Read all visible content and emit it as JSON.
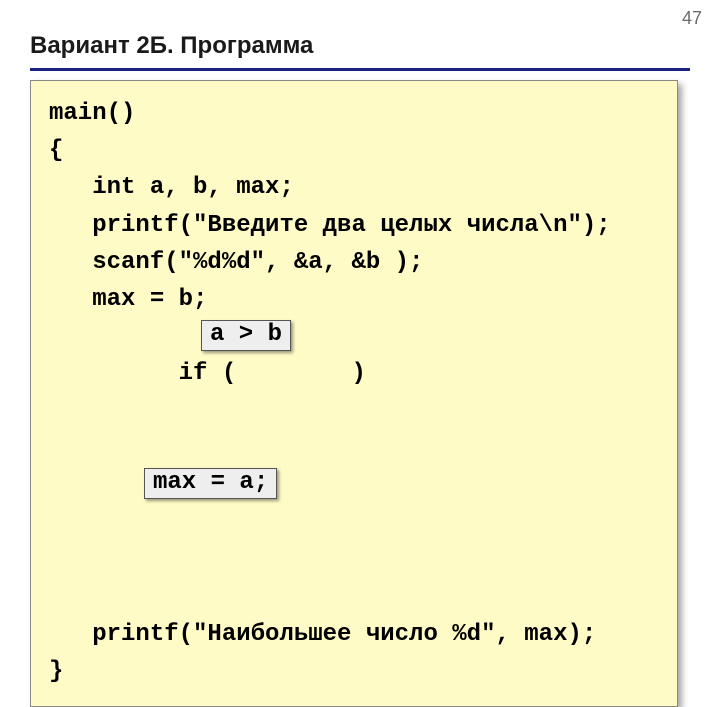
{
  "page_number": "47",
  "title": "Вариант 2Б. Программа",
  "code": {
    "l1": "main()",
    "l2": "{",
    "l3": "   int a, b, max;",
    "l4": "   printf(\"Введите два целых числа\\n\");",
    "l5": "   scanf(\"%d%d\", &a, &b );",
    "l6": "   max = b;",
    "l7_pre": "   if (        )",
    "l8_pre": "              ",
    "l9": "   printf(\"Наибольшее число %d\", max);",
    "l10": "}",
    "callout_condition": "a > b",
    "callout_assignment": "max = a;"
  }
}
